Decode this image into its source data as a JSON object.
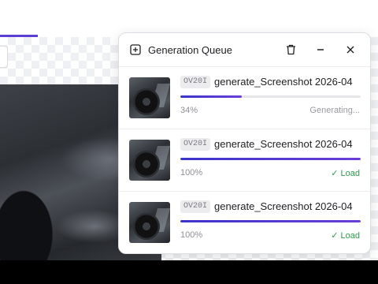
{
  "panel": {
    "title": "Generation Queue",
    "icons": {
      "add": "plus-square-icon",
      "delete": "trash-icon",
      "minimize": "minus-icon",
      "close": "close-icon"
    }
  },
  "items": [
    {
      "badge": "OV20I",
      "filename": "generate_Screenshot 2026-04",
      "progress": 34,
      "percent_label": "34%",
      "status": "Generating..."
    },
    {
      "badge": "OV20I",
      "filename": "generate_Screenshot 2026-04",
      "progress": 100,
      "percent_label": "100%",
      "status": "✓ Load"
    },
    {
      "badge": "OV20I",
      "filename": "generate_Screenshot 2026-04",
      "progress": 100,
      "percent_label": "100%",
      "status": "✓ Load"
    }
  ],
  "colors": {
    "accent": "#5b3fd4",
    "success": "#2e9a4a"
  }
}
